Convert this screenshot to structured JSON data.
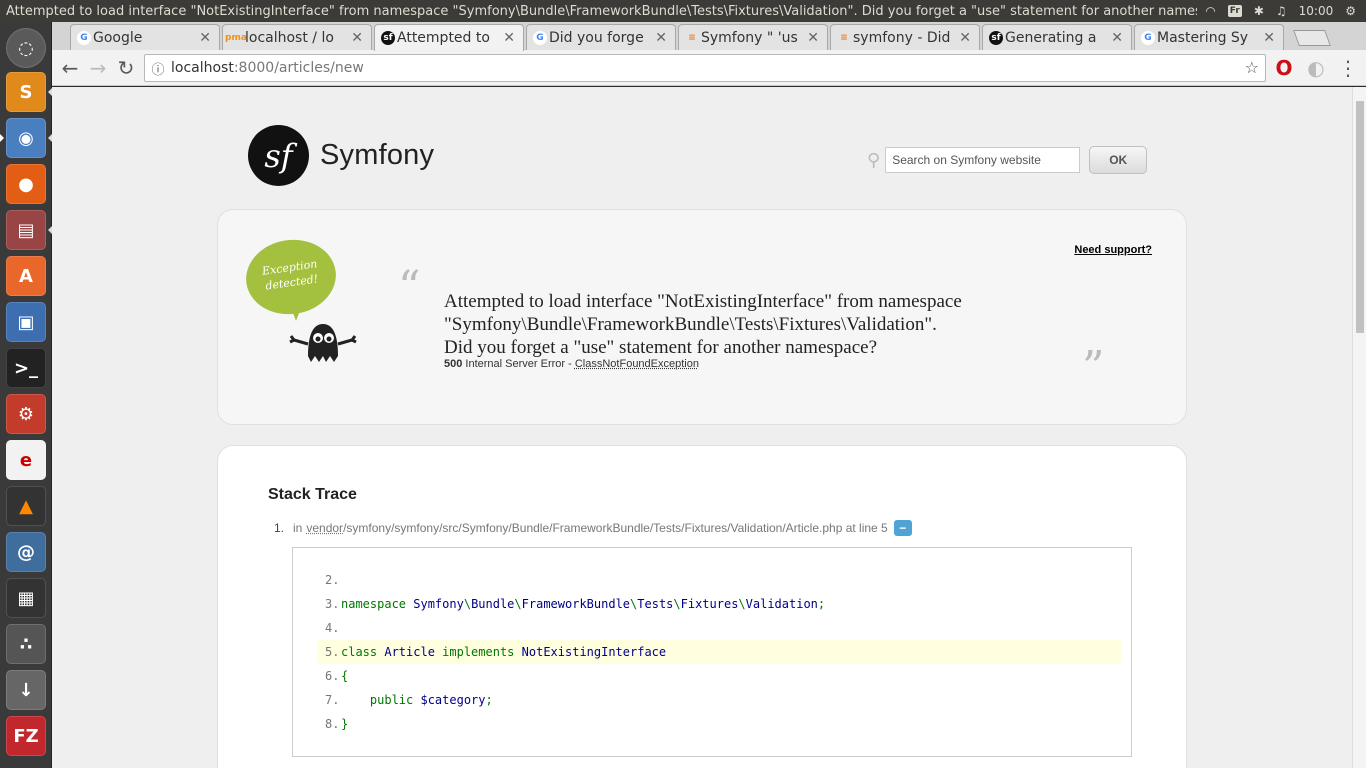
{
  "window_title": "Attempted to load interface \"NotExistingInterface\" from namespace \"Symfony\\Bundle\\FrameworkBundle\\Tests\\Fixtures\\Validation\". Did you forget a \"use\" statement for another namesp",
  "system_tray": {
    "keyboard": "Fr",
    "clock": "10:00"
  },
  "tabs": [
    {
      "label": "Google",
      "icon": "google-icon"
    },
    {
      "label": "localhost / lo",
      "icon": "phpmyadmin-icon"
    },
    {
      "label": "Attempted to",
      "icon": "symfony-icon",
      "active": true
    },
    {
      "label": "Did you forge",
      "icon": "google-icon"
    },
    {
      "label": "Symfony \" 'us",
      "icon": "stackoverflow-icon"
    },
    {
      "label": "symfony - Did",
      "icon": "stackoverflow-icon"
    },
    {
      "label": "Generating a",
      "icon": "symfony-icon"
    },
    {
      "label": "Mastering Sy",
      "icon": "google-icon"
    }
  ],
  "address_bar": {
    "host": "localhost",
    "path": ":8000/articles/new"
  },
  "site": {
    "brand": "Symfony",
    "logo_glyph": "sf"
  },
  "search": {
    "placeholder": "Search on Symfony website",
    "button": "OK"
  },
  "exception": {
    "support_link": "Need support?",
    "bubble_text": "Exception detected!",
    "message_lines": [
      "Attempted to load interface \"NotExistingInterface\" from namespace",
      "\"Symfony\\Bundle\\FrameworkBundle\\Tests\\Fixtures\\Validation\".",
      "Did you forget a \"use\" statement for another namespace?"
    ],
    "status_code": "500",
    "status_text": "Internal Server Error -",
    "exception_class": "ClassNotFoundException",
    "open_quote": "“",
    "close_quote": "”"
  },
  "stack_trace": {
    "title": "Stack Trace",
    "item_number": "1.",
    "in_label": "in",
    "vendor_link": "vendor",
    "file_path": "/symfony/symfony/src/Symfony/Bundle/FrameworkBundle/Tests/Fixtures/Validation/Article.php at line 5",
    "toggle": "−",
    "code_lines": [
      {
        "num": "2.",
        "text": ""
      },
      {
        "num": "3.",
        "text": "namespace Symfony\\Bundle\\FrameworkBundle\\Tests\\Fixtures\\Validation;"
      },
      {
        "num": "4.",
        "text": ""
      },
      {
        "num": "5.",
        "text": "class Article implements NotExistingInterface",
        "highlight": true
      },
      {
        "num": "6.",
        "text": "{"
      },
      {
        "num": "7.",
        "text": "    public $category;"
      },
      {
        "num": "8.",
        "text": "}"
      }
    ]
  },
  "colors": {
    "accent_green": "#a3c03e",
    "toggle_blue": "#4fa4d4",
    "highlight": "#ffffe0"
  }
}
